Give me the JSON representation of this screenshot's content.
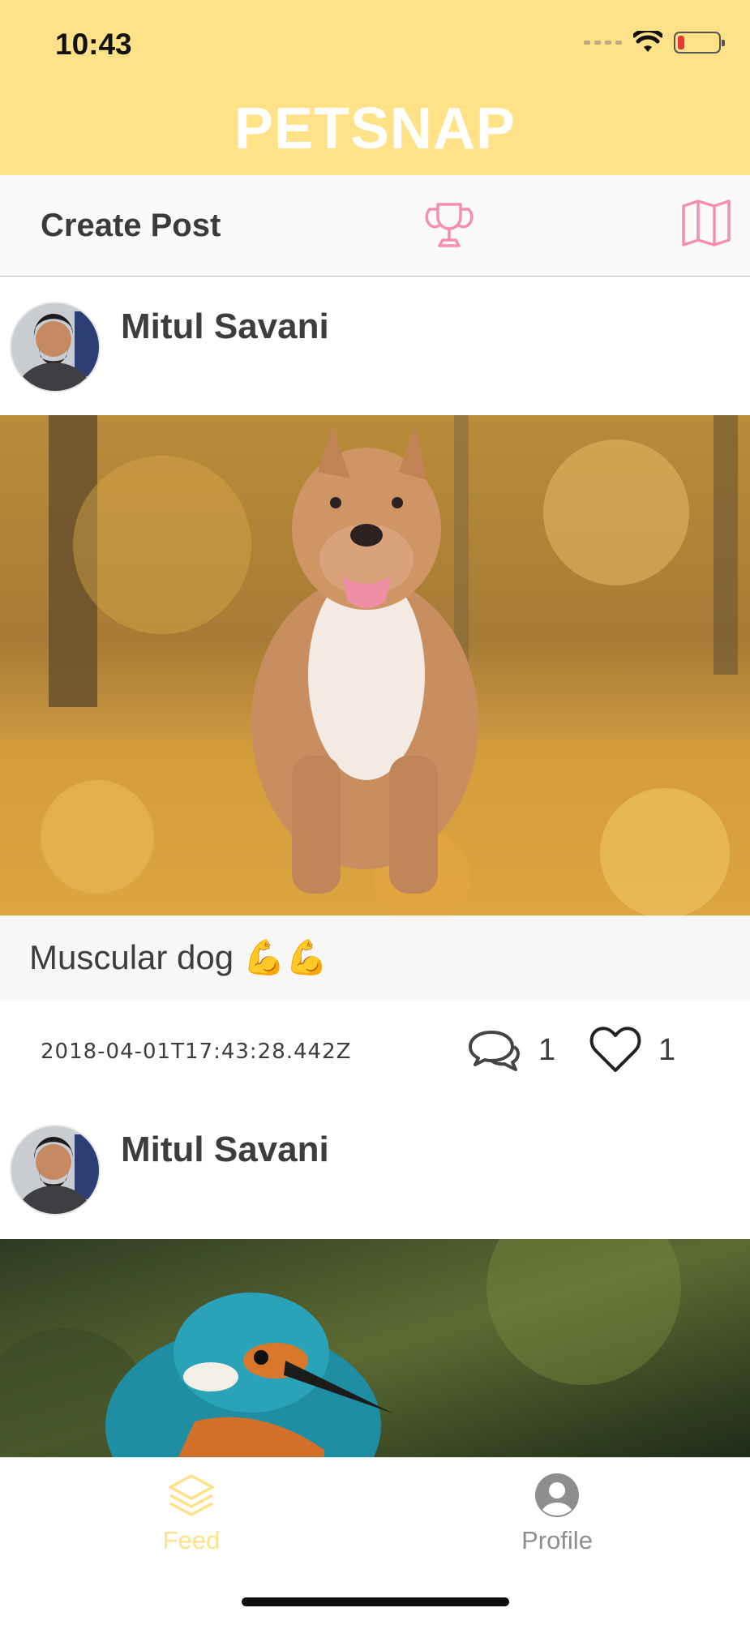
{
  "status_bar": {
    "time": "10:43"
  },
  "app": {
    "title": "PETSNAP"
  },
  "toolbar": {
    "create_post_label": "Create Post",
    "trophy_icon": "trophy-icon",
    "map_icon": "map-icon"
  },
  "posts": [
    {
      "author": "Mitul Savani",
      "image_subject": "dog",
      "caption": "Muscular dog 💪💪",
      "timestamp": "2018-04-01T17:43:28.442Z",
      "comment_count": "1",
      "like_count": "1"
    },
    {
      "author": "Mitul Savani",
      "image_subject": "kingfisher"
    }
  ],
  "tab_bar": {
    "tabs": [
      {
        "label": "Feed",
        "icon": "layers-icon",
        "active": true
      },
      {
        "label": "Profile",
        "icon": "user-icon",
        "active": false
      }
    ]
  },
  "colors": {
    "header_bg": "#FFE187",
    "accent_pink": "#F48FB1",
    "active_tab": "#FFE187",
    "inactive_tab": "#8e8e8e"
  }
}
